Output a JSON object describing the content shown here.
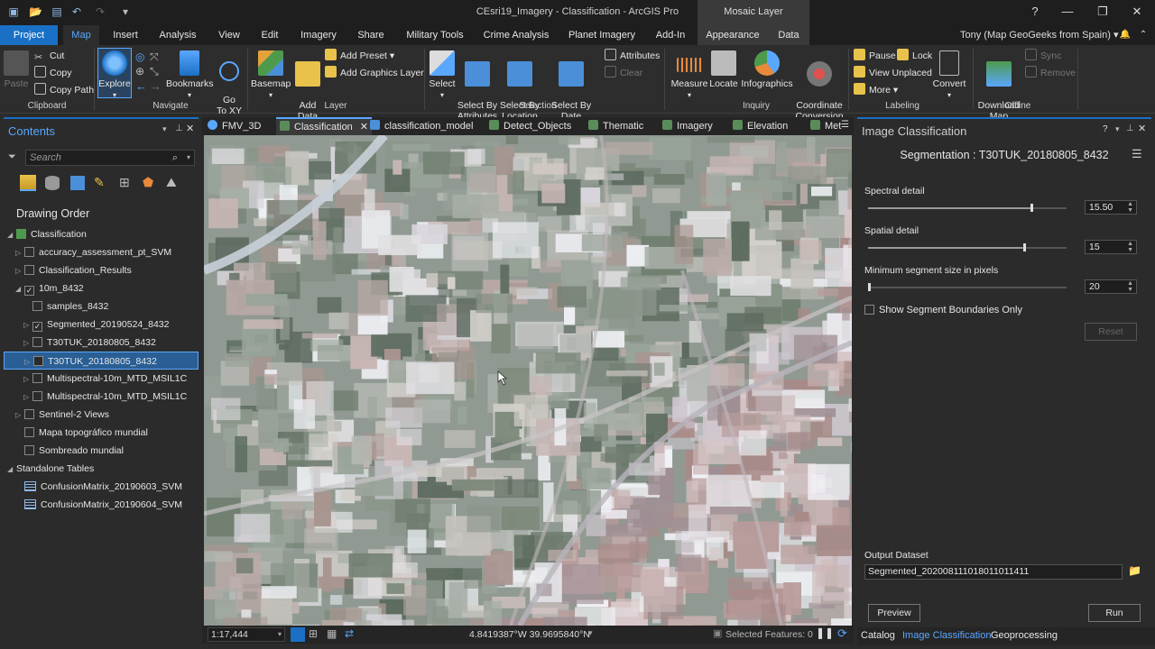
{
  "window": {
    "title": "CEsri19_Imagery - Classification - ArcGIS Pro",
    "context_header": "Mosaic Layer",
    "help": "?",
    "minimize": "—",
    "restore": "❐",
    "close": "✕"
  },
  "ribbon_tabs": [
    "Project",
    "Map",
    "Insert",
    "Analysis",
    "View",
    "Edit",
    "Imagery",
    "Share",
    "Military Tools",
    "Crime Analysis",
    "Planet Imagery",
    "Add-In",
    "Appearance",
    "Data"
  ],
  "user": "Tony (Map GeoGeeks from Spain) ▾",
  "ribbon": {
    "clipboard": {
      "label": "Clipboard",
      "paste": "Paste",
      "cut": "Cut",
      "copy": "Copy",
      "copy_path": "Copy Path"
    },
    "navigate": {
      "label": "Navigate",
      "explore": "Explore",
      "bookmarks": "Bookmarks",
      "go_to_xy": "Go\nTo XY"
    },
    "layer": {
      "label": "Layer",
      "basemap": "Basemap",
      "add_data": "Add\nData",
      "add_preset": "Add Preset",
      "add_graphics_layer": "Add Graphics Layer"
    },
    "selection": {
      "label": "Selection",
      "select": "Select",
      "select_by_attributes": "Select By\nAttributes",
      "select_by_location": "Select By\nLocation",
      "select_by_date": "Select By Date\nand Time",
      "attributes": "Attributes",
      "clear": "Clear"
    },
    "inquiry": {
      "label": "Inquiry",
      "measure": "Measure",
      "locate": "Locate",
      "infographics": "Infographics",
      "coordinate_conversion": "Coordinate\nConversion"
    },
    "labeling": {
      "label": "Labeling",
      "pause": "Pause",
      "lock": "Lock",
      "view_unplaced": "View Unplaced",
      "more": "More",
      "convert": "Convert"
    },
    "offline": {
      "label": "Offline",
      "download_map": "Download\nMap",
      "sync": "Sync",
      "remove": "Remove"
    }
  },
  "contents": {
    "title": "Contents",
    "search_placeholder": "Search",
    "drawing_order": "Drawing Order",
    "items": [
      {
        "label": "Classification",
        "level": 0,
        "expander": "◢",
        "checkbox": false,
        "icon": "map"
      },
      {
        "label": "accuracy_assessment_pt_SVM",
        "level": 1,
        "expander": "▷",
        "checked": false
      },
      {
        "label": "Classification_Results",
        "level": 1,
        "expander": "▷",
        "checked": false
      },
      {
        "label": "10m_8432",
        "level": 1,
        "expander": "◢",
        "checked": true
      },
      {
        "label": "samples_8432",
        "level": 2,
        "expander": "",
        "checked": false
      },
      {
        "label": "Segmented_20190524_8432",
        "level": 2,
        "expander": "▷",
        "checked": true
      },
      {
        "label": "T30TUK_20180805_8432",
        "level": 2,
        "expander": "▷",
        "checked": false
      },
      {
        "label": "T30TUK_20180805_8432",
        "level": 2,
        "expander": "▷",
        "checked": false,
        "selected": true
      },
      {
        "label": "Multispectral-10m_MTD_MSIL1C",
        "level": 2,
        "expander": "▷",
        "checked": false
      },
      {
        "label": "Multispectral-10m_MTD_MSIL1C",
        "level": 2,
        "expander": "▷",
        "checked": false
      },
      {
        "label": "Sentinel-2 Views",
        "level": 1,
        "expander": "▷",
        "checked": false
      },
      {
        "label": "Mapa topográfico mundial",
        "level": 1,
        "expander": "",
        "checked": false
      },
      {
        "label": "Sombreado mundial",
        "level": 1,
        "expander": "",
        "checked": false
      },
      {
        "label": "Standalone Tables",
        "level": 0,
        "expander": "◢",
        "checkbox": false
      },
      {
        "label": "ConfusionMatrix_20190603_SVM",
        "level": 1,
        "expander": "",
        "checkbox": false,
        "icon": "table"
      },
      {
        "label": "ConfusionMatrix_20190604_SVM",
        "level": 1,
        "expander": "",
        "checkbox": false,
        "icon": "table"
      }
    ]
  },
  "map_tabs": [
    "FMV_3D",
    "Classification",
    "classification_model",
    "Detect_Objects",
    "Thematic",
    "Imagery",
    "Elevation",
    "Met"
  ],
  "status": {
    "scale": "1:17,444",
    "coordinates": "4.8419387°W 39.9695840°N",
    "selected_features": "Selected Features: 0"
  },
  "image_classification": {
    "title": "Image Classification",
    "heading": "Segmentation : T30TUK_20180805_8432",
    "spectral_detail_label": "Spectral detail",
    "spectral_detail_value": "15.50",
    "spectral_detail_fraction": 0.82,
    "spatial_detail_label": "Spatial detail",
    "spatial_detail_value": "15",
    "spatial_detail_fraction": 0.78,
    "min_segment_label": "Minimum segment size in pixels",
    "min_segment_value": "20",
    "min_segment_fraction": 0.0,
    "show_boundaries_label": "Show Segment Boundaries Only",
    "reset_label": "Reset",
    "output_dataset_label": "Output Dataset",
    "output_dataset_value": "Segmented_20200811101801101​1411",
    "preview_label": "Preview",
    "run_label": "Run"
  },
  "bottom_tabs": [
    "Catalog",
    "Image Classification",
    "Geoprocessing"
  ],
  "colors": {
    "accent": "#1a70c5",
    "highlight": "#5aa7ff",
    "background": "#2b2b2b"
  }
}
